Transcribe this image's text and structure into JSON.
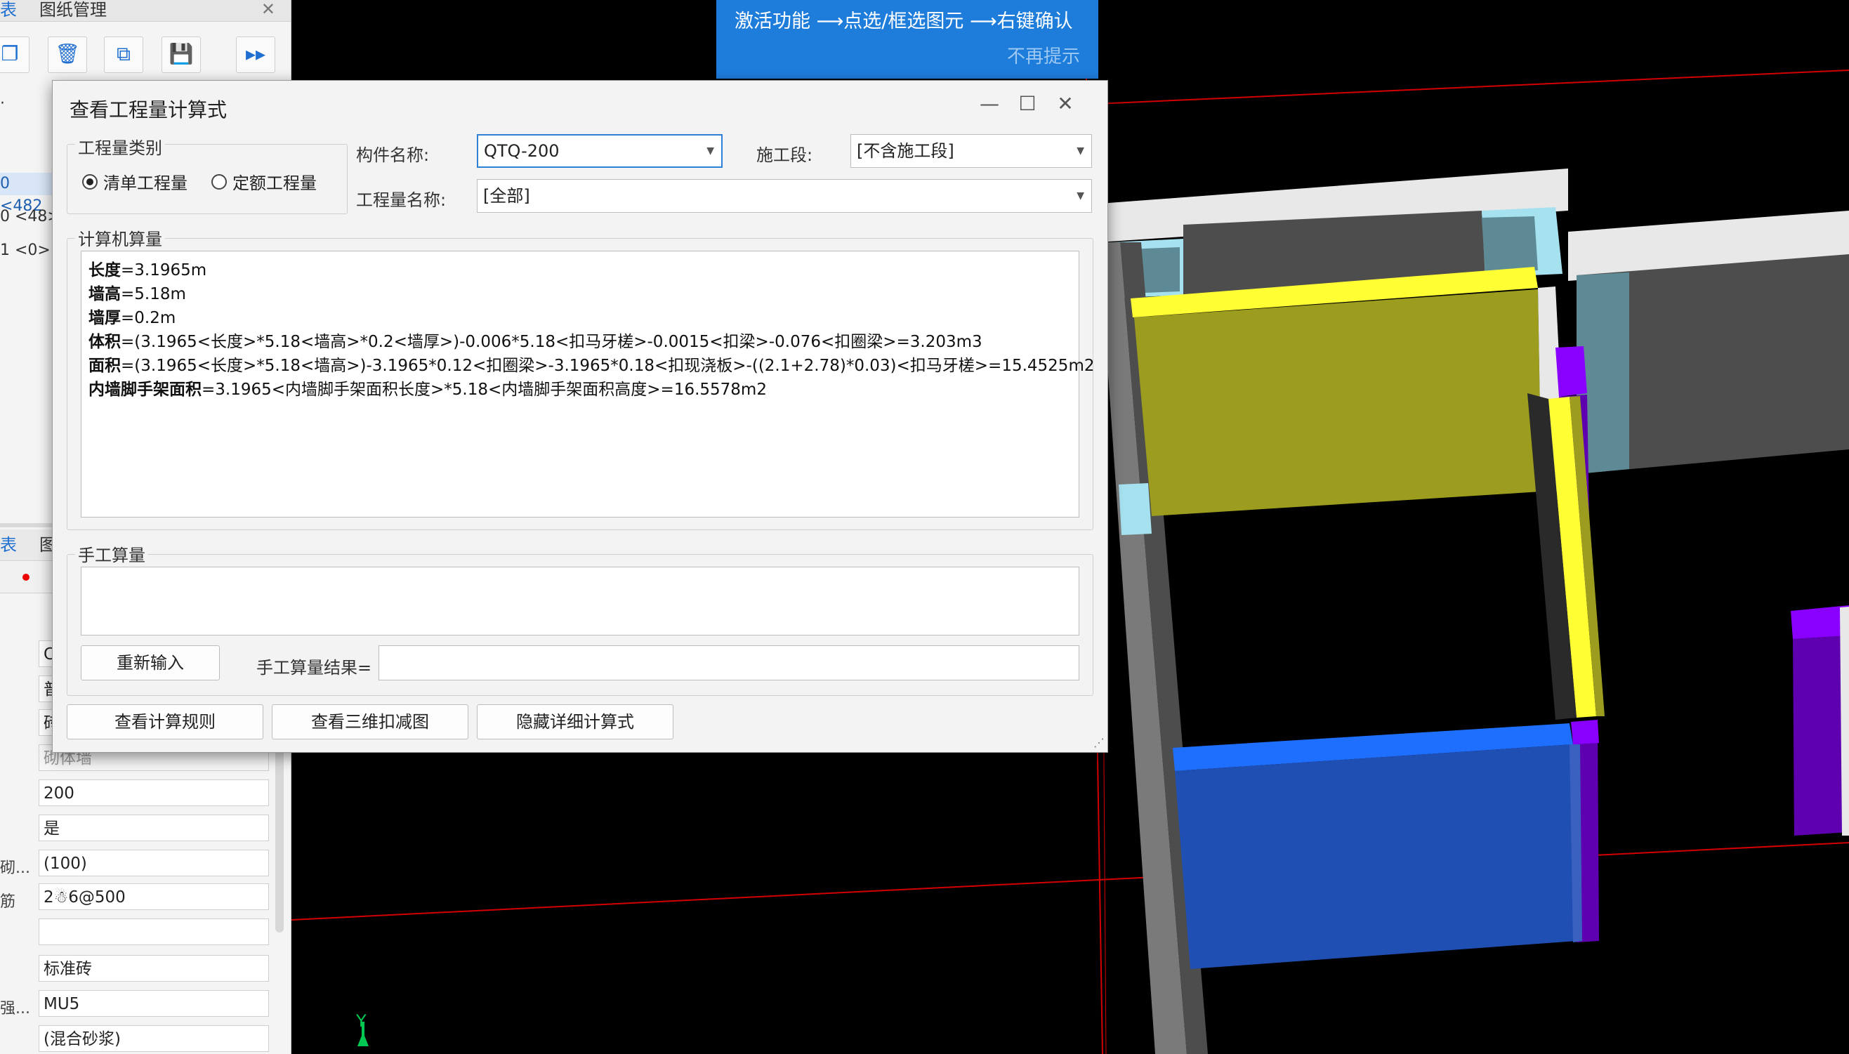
{
  "left_panel": {
    "tabs": [
      {
        "label": "表"
      },
      {
        "label": "图纸管理"
      }
    ],
    "list_rows": [
      "0 <482",
      "0 <48>",
      "1 <0>"
    ],
    "top_marker": "·",
    "tabs2": [
      {
        "label": "表"
      },
      {
        "label": "图"
      }
    ],
    "props": [
      {
        "label": "",
        "value": "C"
      },
      {
        "label": "",
        "value": "普"
      },
      {
        "label": "",
        "value": "砖"
      },
      {
        "label": "",
        "value": "砌体墙"
      },
      {
        "label": "",
        "value": "200"
      },
      {
        "label": "",
        "value": "是"
      },
      {
        "label": "砌...",
        "value": "(100)"
      },
      {
        "label": "筋",
        "value": "2☃6@500"
      },
      {
        "label": "",
        "value": ""
      },
      {
        "label": "",
        "value": "标准砖"
      },
      {
        "label": "强...",
        "value": "MU5"
      },
      {
        "label": "",
        "value": "(混合砂浆)"
      }
    ]
  },
  "hint": {
    "message": "激活功能 ⟶点选/框选图元 ⟶右键确认",
    "dismiss": "不再提示"
  },
  "dialog": {
    "title": "查看工程量计算式",
    "quantity_type": {
      "title": "工程量类别",
      "options": [
        {
          "label": "清单工程量",
          "selected": true
        },
        {
          "label": "定额工程量",
          "selected": false
        }
      ]
    },
    "component_name": {
      "label": "构件名称:",
      "value": "QTQ-200"
    },
    "construction_stage": {
      "label": "施工段:",
      "value": "[不含施工段]"
    },
    "quantity_name": {
      "label": "工程量名称:",
      "value": "[全部]"
    },
    "computer_calc": {
      "title": "计算机算量",
      "lines": [
        {
          "name": "长度",
          "expr": "=3.1965m"
        },
        {
          "name": "墙高",
          "expr": "=5.18m"
        },
        {
          "name": "墙厚",
          "expr": "=0.2m"
        },
        {
          "name": "体积",
          "expr": "=(3.1965<长度>*5.18<墙高>*0.2<墙厚>)-0.006*5.18<扣马牙槎>-0.0015<扣梁>-0.076<扣圈梁>=3.203m3"
        },
        {
          "name": "面积",
          "expr": "=(3.1965<长度>*5.18<墙高>)-3.1965*0.12<扣圈梁>-3.1965*0.18<扣现浇板>-((2.1+2.78)*0.03)<扣马牙槎>=15.4525m2"
        },
        {
          "name": "内墙脚手架面积",
          "expr": "=3.1965<内墙脚手架面积长度>*5.18<内墙脚手架面积高度>=16.5578m2"
        }
      ]
    },
    "manual_calc": {
      "title": "手工算量",
      "reenter_label": "重新输入",
      "result_label": "手工算量结果=",
      "result_value": ""
    },
    "buttons": {
      "view_rules": "查看计算规则",
      "view_3d": "查看三维扣减图",
      "hide_detail": "隐藏详细计算式"
    }
  },
  "axis_label": "Y",
  "colors": {
    "accent": "#1e7ddb",
    "wall_gray": "#4d4d4d",
    "wall_light": "#e8e8e8",
    "column_cyan": "#a6e1f0",
    "beam_yellow": "#ffff33",
    "wall_olive": "#9c9c1e",
    "wall_blue": "#1f4fb3",
    "beam_blue": "#1f6fff",
    "purple": "#8a00ff",
    "grid_red": "#d40000"
  }
}
